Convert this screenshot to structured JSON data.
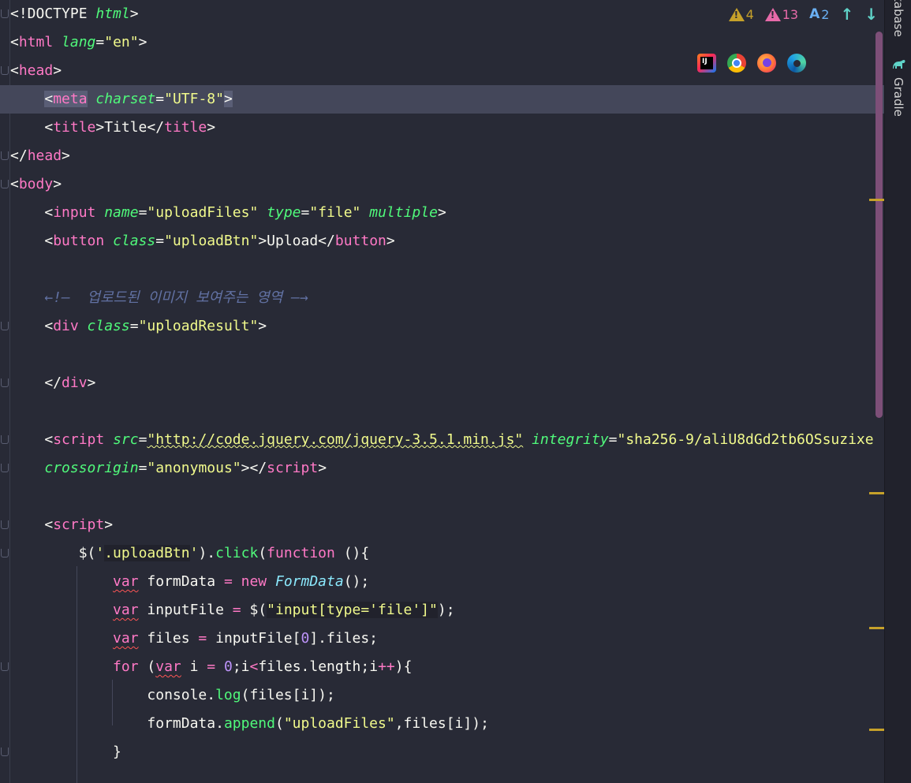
{
  "code_lines": [
    [
      {
        "t": "<!DOCTYPE ",
        "c": "punc"
      },
      {
        "t": "html",
        "c": "attr"
      },
      {
        "t": ">",
        "c": "punc"
      }
    ],
    [
      {
        "t": "<",
        "c": "punc"
      },
      {
        "t": "html",
        "c": "tag"
      },
      {
        "t": " ",
        "c": "punc"
      },
      {
        "t": "lang",
        "c": "attr"
      },
      {
        "t": "=",
        "c": "punc"
      },
      {
        "t": "\"en\"",
        "c": "str"
      },
      {
        "t": ">",
        "c": "punc"
      }
    ],
    [
      {
        "t": "<",
        "c": "punc"
      },
      {
        "t": "head",
        "c": "tag"
      },
      {
        "t": ">",
        "c": "punc"
      }
    ],
    [
      {
        "t": "    ",
        "c": "punc"
      },
      {
        "t": "<",
        "c": "punc meta-hl"
      },
      {
        "t": "meta",
        "c": "tag meta-hl"
      },
      {
        "t": " ",
        "c": "punc"
      },
      {
        "t": "charset",
        "c": "attr"
      },
      {
        "t": "=",
        "c": "punc"
      },
      {
        "t": "\"UTF-8\"",
        "c": "str"
      },
      {
        "t": ">",
        "c": "punc meta-hl"
      }
    ],
    [
      {
        "t": "    <",
        "c": "punc"
      },
      {
        "t": "title",
        "c": "tag"
      },
      {
        "t": ">Title</",
        "c": "punc"
      },
      {
        "t": "title",
        "c": "tag"
      },
      {
        "t": ">",
        "c": "punc"
      }
    ],
    [
      {
        "t": "</",
        "c": "punc"
      },
      {
        "t": "head",
        "c": "tag"
      },
      {
        "t": ">",
        "c": "punc"
      }
    ],
    [
      {
        "t": "<",
        "c": "punc"
      },
      {
        "t": "body",
        "c": "tag"
      },
      {
        "t": ">",
        "c": "punc"
      }
    ],
    [
      {
        "t": "    <",
        "c": "punc"
      },
      {
        "t": "input",
        "c": "tag"
      },
      {
        "t": " ",
        "c": "punc"
      },
      {
        "t": "name",
        "c": "attr"
      },
      {
        "t": "=",
        "c": "punc"
      },
      {
        "t": "\"uploadFiles\"",
        "c": "str"
      },
      {
        "t": " ",
        "c": "punc"
      },
      {
        "t": "type",
        "c": "attr"
      },
      {
        "t": "=",
        "c": "punc"
      },
      {
        "t": "\"file\"",
        "c": "str"
      },
      {
        "t": " ",
        "c": "punc"
      },
      {
        "t": "multiple",
        "c": "attr"
      },
      {
        "t": ">",
        "c": "punc"
      }
    ],
    [
      {
        "t": "    <",
        "c": "punc"
      },
      {
        "t": "button",
        "c": "tag"
      },
      {
        "t": " ",
        "c": "punc"
      },
      {
        "t": "class",
        "c": "attr"
      },
      {
        "t": "=",
        "c": "punc"
      },
      {
        "t": "\"uploadBtn\"",
        "c": "str"
      },
      {
        "t": ">Upload</",
        "c": "punc"
      },
      {
        "t": "button",
        "c": "tag"
      },
      {
        "t": ">",
        "c": "punc"
      }
    ],
    [],
    [
      {
        "t": "    ←!—  업로드된 이미지 보여주는 영역 —→",
        "c": "com"
      }
    ],
    [
      {
        "t": "    <",
        "c": "punc"
      },
      {
        "t": "div",
        "c": "tag"
      },
      {
        "t": " ",
        "c": "punc"
      },
      {
        "t": "class",
        "c": "attr"
      },
      {
        "t": "=",
        "c": "punc"
      },
      {
        "t": "\"uploadResult\"",
        "c": "str"
      },
      {
        "t": ">",
        "c": "punc"
      }
    ],
    [],
    [
      {
        "t": "    </",
        "c": "punc"
      },
      {
        "t": "div",
        "c": "tag"
      },
      {
        "t": ">",
        "c": "punc"
      }
    ],
    [],
    [
      {
        "t": "    <",
        "c": "punc"
      },
      {
        "t": "script",
        "c": "tag"
      },
      {
        "t": " ",
        "c": "punc"
      },
      {
        "t": "src",
        "c": "attr"
      },
      {
        "t": "=",
        "c": "punc"
      },
      {
        "t": "\"http://code.jquery.com/jquery-3.5.1.min.js\"",
        "c": "str-u"
      },
      {
        "t": " ",
        "c": "punc"
      },
      {
        "t": "integrity",
        "c": "attr"
      },
      {
        "t": "=",
        "c": "punc"
      },
      {
        "t": "\"sha256-9/aliU8dGd2tb6OSsuzixe",
        "c": "str"
      }
    ],
    [
      {
        "t": "    ",
        "c": "punc"
      },
      {
        "t": "crossorigin",
        "c": "attr"
      },
      {
        "t": "=",
        "c": "punc"
      },
      {
        "t": "\"anonymous\"",
        "c": "str"
      },
      {
        "t": "></",
        "c": "punc"
      },
      {
        "t": "script",
        "c": "tag"
      },
      {
        "t": ">",
        "c": "punc"
      }
    ],
    [],
    [
      {
        "t": "    <",
        "c": "punc"
      },
      {
        "t": "script",
        "c": "tag"
      },
      {
        "t": ">",
        "c": "punc"
      }
    ],
    [
      {
        "t": "        $(",
        "c": "id"
      },
      {
        "t": "'",
        "c": "str"
      },
      {
        "t": ".uploadBtn",
        "c": "str jqs"
      },
      {
        "t": "'",
        "c": "str"
      },
      {
        "t": ").",
        "c": "id"
      },
      {
        "t": "click",
        "c": "fn"
      },
      {
        "t": "(",
        "c": "id"
      },
      {
        "t": "function",
        "c": "kw"
      },
      {
        "t": " (){",
        "c": "id"
      }
    ],
    [
      {
        "t": "            ",
        "c": "id"
      },
      {
        "t": "var",
        "c": "kw-u"
      },
      {
        "t": " formData ",
        "c": "id"
      },
      {
        "t": "=",
        "c": "kw"
      },
      {
        "t": " ",
        "c": "id"
      },
      {
        "t": "new",
        "c": "kw"
      },
      {
        "t": " ",
        "c": "id"
      },
      {
        "t": "FormData",
        "c": "cls"
      },
      {
        "t": "();",
        "c": "id"
      }
    ],
    [
      {
        "t": "            ",
        "c": "id"
      },
      {
        "t": "var",
        "c": "kw-u"
      },
      {
        "t": " inputFile ",
        "c": "id"
      },
      {
        "t": "=",
        "c": "kw"
      },
      {
        "t": " $(",
        "c": "id"
      },
      {
        "t": "\"input[type='file']\"",
        "c": "str jqs"
      },
      {
        "t": ");",
        "c": "id"
      }
    ],
    [
      {
        "t": "            ",
        "c": "id"
      },
      {
        "t": "var",
        "c": "kw-u"
      },
      {
        "t": " files ",
        "c": "id"
      },
      {
        "t": "=",
        "c": "kw"
      },
      {
        "t": " inputFile[",
        "c": "id"
      },
      {
        "t": "0",
        "c": "num"
      },
      {
        "t": "].files;",
        "c": "id"
      }
    ],
    [
      {
        "t": "            ",
        "c": "id"
      },
      {
        "t": "for",
        "c": "kw"
      },
      {
        "t": " (",
        "c": "id"
      },
      {
        "t": "var",
        "c": "kw-u"
      },
      {
        "t": " i ",
        "c": "id"
      },
      {
        "t": "=",
        "c": "kw"
      },
      {
        "t": " ",
        "c": "id"
      },
      {
        "t": "0",
        "c": "num"
      },
      {
        "t": ";i",
        "c": "id"
      },
      {
        "t": "<",
        "c": "kw"
      },
      {
        "t": "files.length;i",
        "c": "id"
      },
      {
        "t": "++",
        "c": "kw"
      },
      {
        "t": "){",
        "c": "id"
      }
    ],
    [
      {
        "t": "                console.",
        "c": "id"
      },
      {
        "t": "log",
        "c": "fn"
      },
      {
        "t": "(files[i]);",
        "c": "id"
      }
    ],
    [
      {
        "t": "                formData.",
        "c": "id"
      },
      {
        "t": "append",
        "c": "fn"
      },
      {
        "t": "(",
        "c": "id"
      },
      {
        "t": "\"uploadFiles\"",
        "c": "str"
      },
      {
        "t": ",files[i]);",
        "c": "id"
      }
    ],
    [
      {
        "t": "            }",
        "c": "id"
      }
    ]
  ],
  "current_line_index": 3,
  "inspections": {
    "warnings_count": "4",
    "errors_count": "13",
    "typos_count": "2",
    "typo_label": "A"
  },
  "toolbar": {
    "up_arrow": "↑",
    "down_arrow": "↓",
    "intellij_label": "IJ"
  },
  "right_panel": {
    "database_label": "tabase",
    "gradle_label": "Gradle"
  },
  "colors": {
    "background": "#282a36",
    "current_line": "#44475a",
    "tag": "#ff79c6",
    "attribute": "#50fa7b",
    "string": "#f1fa8c",
    "comment": "#6272a4",
    "number": "#bd93f9",
    "class": "#8be9fd",
    "warning": "#c6a12a",
    "error": "#e76aa9"
  }
}
